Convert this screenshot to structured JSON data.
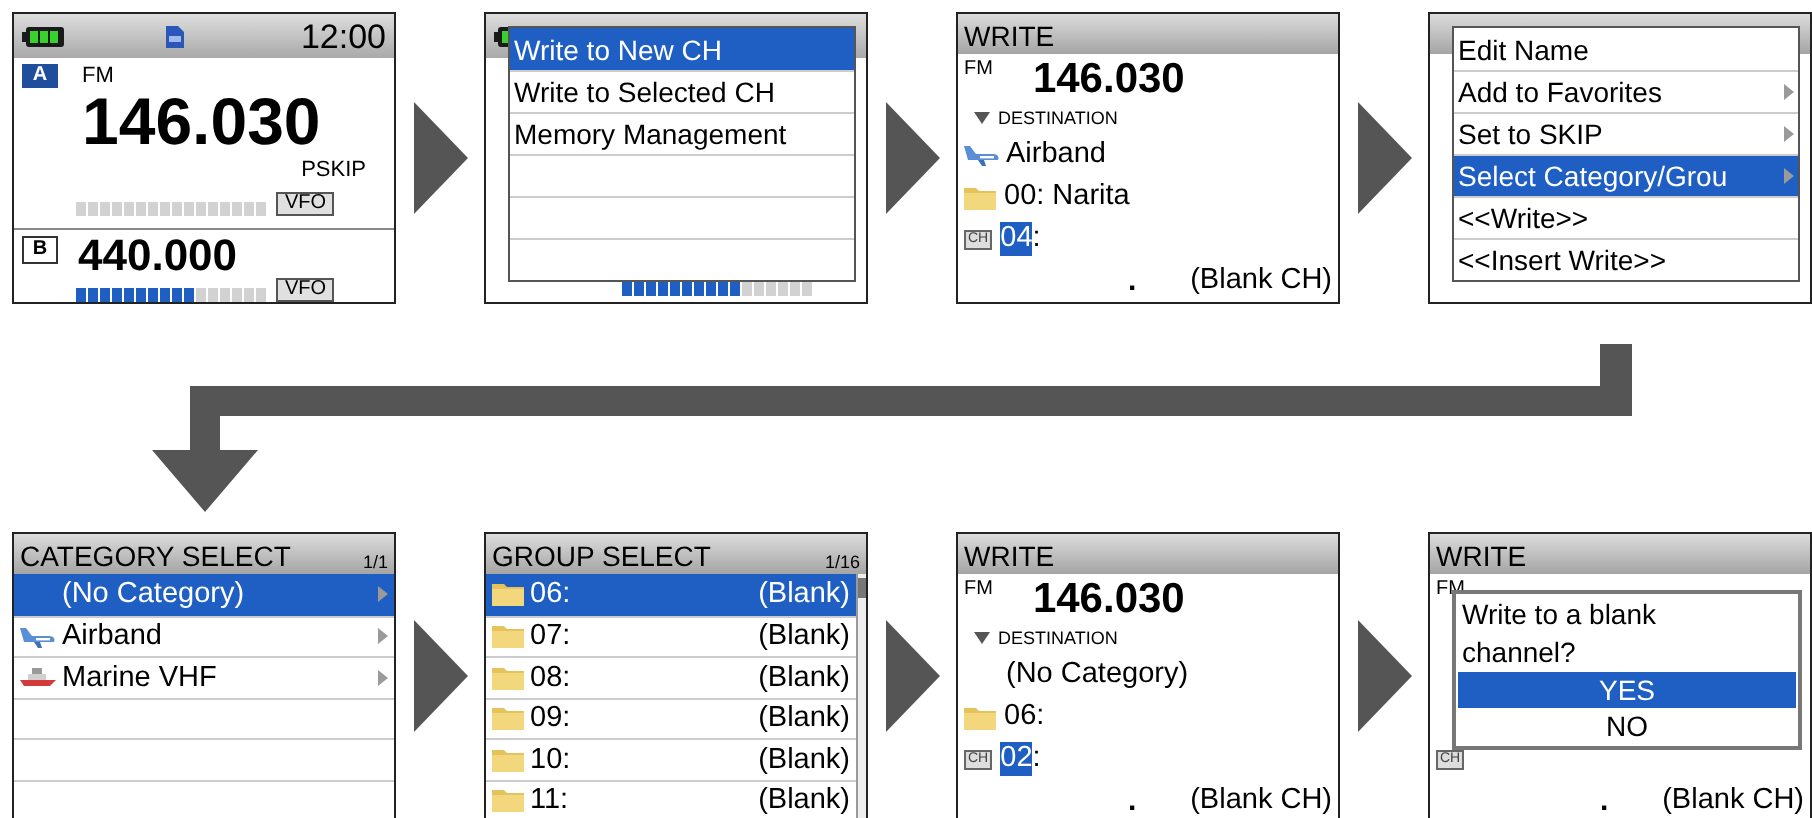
{
  "steps": [
    {
      "kind": "main",
      "time": "12:00",
      "bands": [
        {
          "label": "A",
          "selected": true,
          "mode": "FM",
          "frequency": "146.030",
          "tag": "PSKIP",
          "vfo": "VFO"
        },
        {
          "label": "B",
          "selected": false,
          "frequency": "440.000",
          "vfo": "VFO",
          "level": 0.625
        }
      ]
    },
    {
      "kind": "menu",
      "backdrop": {
        "kind": "main",
        "level": 0.625
      },
      "menu": [
        {
          "label": "Write to New CH",
          "selected": true,
          "submenu": false
        },
        {
          "label": "Write to Selected CH",
          "selected": false,
          "submenu": false
        },
        {
          "label": "Memory Management",
          "selected": false,
          "submenu": false
        }
      ]
    },
    {
      "kind": "write",
      "title": "WRITE",
      "mode": "FM",
      "frequency": "146.030",
      "destination": "DESTINATION",
      "category": {
        "kind": "aircraft",
        "name": "Airband"
      },
      "group": "00: Narita",
      "channel_badge": "CH",
      "channel": "04",
      "channel_separator": ":",
      "cursor_mark": ".",
      "channel_name": "(Blank CH)"
    },
    {
      "kind": "menu",
      "backdrop": {
        "kind": "write"
      },
      "menu": [
        {
          "label": "Edit Name",
          "selected": false,
          "submenu": false
        },
        {
          "label": "Add to Favorites",
          "selected": false,
          "submenu": true
        },
        {
          "label": "Set to SKIP",
          "selected": false,
          "submenu": true
        },
        {
          "label": "Select Category/Grou",
          "selected": true,
          "submenu": true
        },
        {
          "label": "<<Write>>",
          "selected": false,
          "submenu": false
        },
        {
          "label": "<<Insert Write>>",
          "selected": false,
          "submenu": false
        }
      ]
    },
    {
      "kind": "list",
      "title": "CATEGORY SELECT",
      "page": "1/1",
      "scrollbar": false,
      "items": [
        {
          "kind": "plain",
          "label": "(No Category)",
          "selected": true,
          "submenu": true
        },
        {
          "kind": "aircraft",
          "label": "Airband",
          "selected": false,
          "submenu": true
        },
        {
          "kind": "ship",
          "label": "Marine VHF",
          "selected": false,
          "submenu": true
        }
      ]
    },
    {
      "kind": "list",
      "title": "GROUP SELECT",
      "page": "1/16",
      "scrollbar": true,
      "items": [
        {
          "kind": "folder",
          "label": "06:",
          "value": "(Blank)",
          "selected": true,
          "submenu": false
        },
        {
          "kind": "folder",
          "label": "07:",
          "value": "(Blank)",
          "selected": false,
          "submenu": false
        },
        {
          "kind": "folder",
          "label": "08:",
          "value": "(Blank)",
          "selected": false,
          "submenu": false
        },
        {
          "kind": "folder",
          "label": "09:",
          "value": "(Blank)",
          "selected": false,
          "submenu": false
        },
        {
          "kind": "folder",
          "label": "10:",
          "value": "(Blank)",
          "selected": false,
          "submenu": false
        },
        {
          "kind": "folder",
          "label": "11:",
          "value": "(Blank)",
          "selected": false,
          "submenu": false
        }
      ]
    },
    {
      "kind": "write",
      "title": "WRITE",
      "mode": "FM",
      "frequency": "146.030",
      "destination": "DESTINATION",
      "category": {
        "kind": "plain",
        "name": "(No Category)"
      },
      "group": "06:",
      "channel_badge": "CH",
      "channel": "02",
      "channel_separator": ":",
      "cursor_mark": ".",
      "channel_name": "(Blank CH)"
    },
    {
      "kind": "dialog",
      "backdrop": {
        "kind": "write",
        "title": "WRITE",
        "mode": "FM",
        "channel_badge": "CH",
        "cursor_mark": ".",
        "channel_name": "(Blank CH)"
      },
      "message": "Write to a blank channel?",
      "options": [
        {
          "label": "YES",
          "selected": true
        },
        {
          "label": "NO",
          "selected": false
        }
      ]
    }
  ]
}
